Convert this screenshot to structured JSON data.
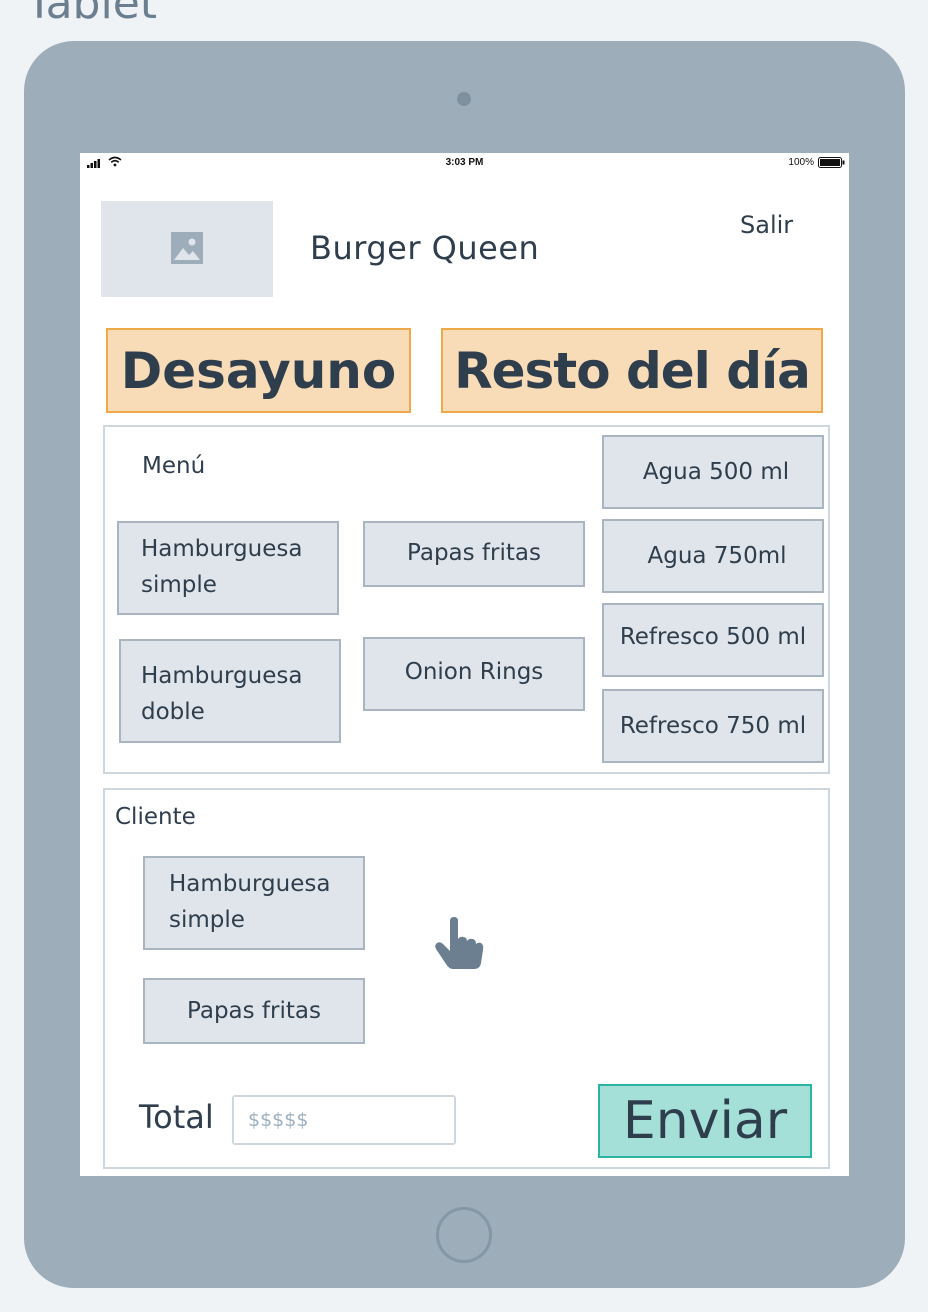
{
  "page_label": "Tablet",
  "status_bar": {
    "time": "3:03 PM",
    "battery": "100%"
  },
  "header": {
    "title": "Burger Queen",
    "logout": "Salir"
  },
  "categories": {
    "breakfast": "Desayuno",
    "rest_of_day": "Resto del día"
  },
  "menu": {
    "label": "Menú",
    "items": {
      "burger_simple": [
        "Hamburguesa",
        "simple"
      ],
      "burger_double": [
        "Hamburguesa",
        "doble"
      ],
      "fries": "Papas fritas",
      "onion_rings": "Onion Rings",
      "water_500": "Agua 500 ml",
      "water_750": "Agua 750ml",
      "soda_500": "Refresco 500 ml",
      "soda_750": "Refresco 750 ml"
    }
  },
  "client": {
    "label": "Cliente",
    "order_items": {
      "burger_simple": [
        "Hamburguesa",
        "simple"
      ],
      "fries": "Papas fritas"
    },
    "total_label": "Total",
    "total_placeholder": "$$$$$",
    "send": "Enviar"
  },
  "colors": {
    "device": "#9dadba",
    "tab_fill": "#f8dbb7",
    "tab_border": "#f0a94a",
    "button_fill": "#dfe5eb",
    "send_fill": "#a4dfd8",
    "send_border": "#2bb3a3"
  }
}
